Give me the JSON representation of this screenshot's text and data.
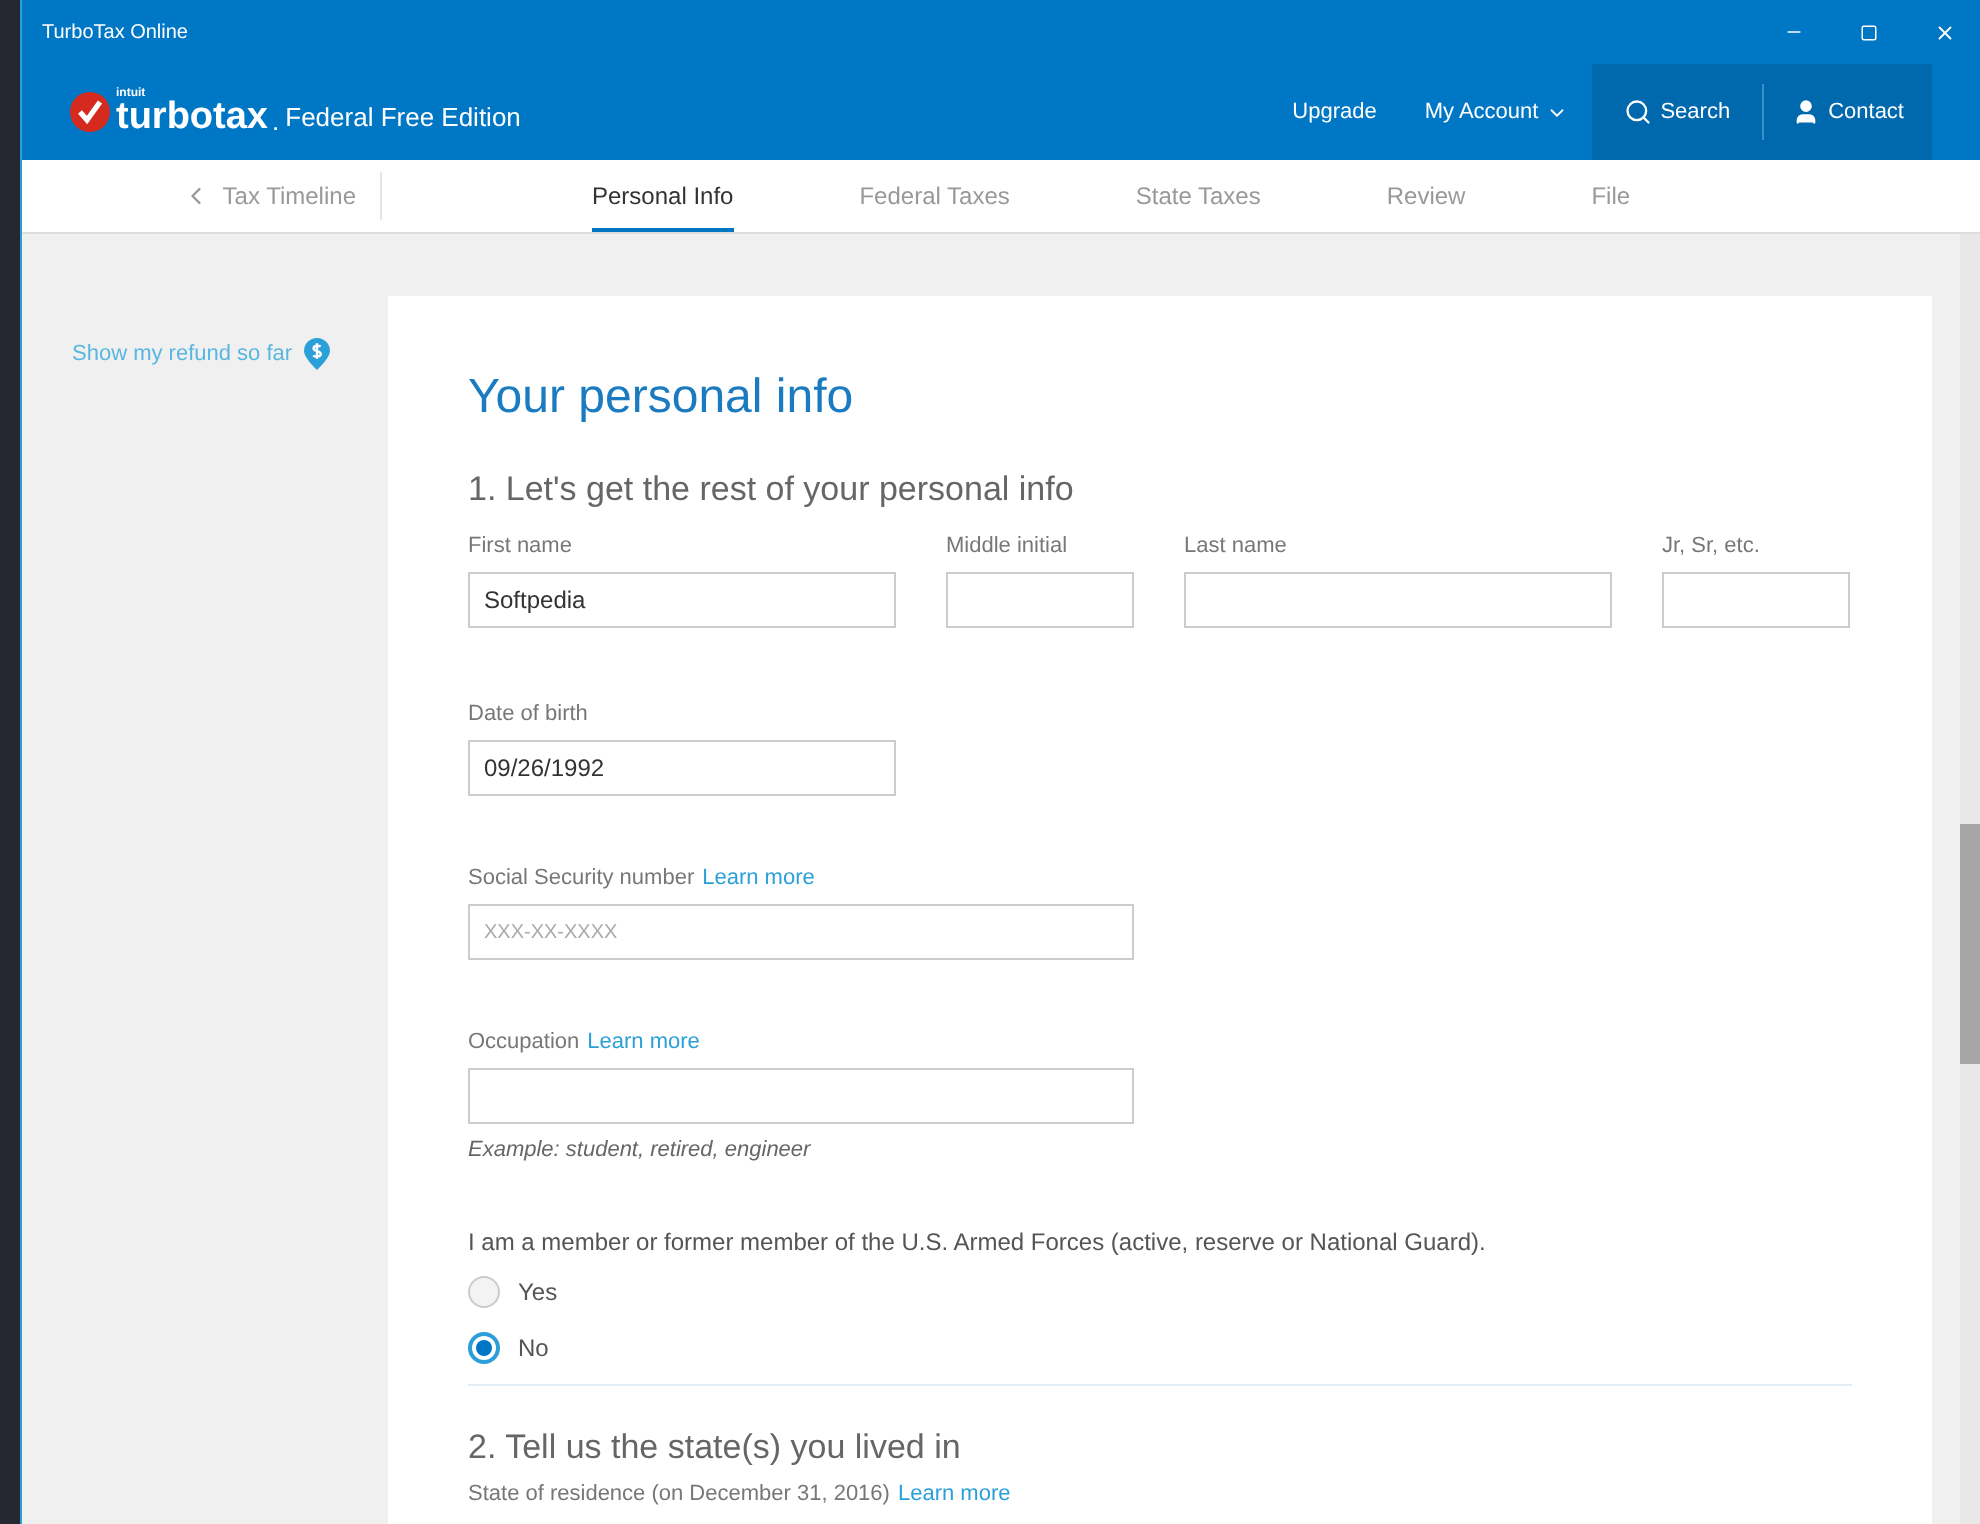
{
  "window": {
    "title": "TurboTax Online"
  },
  "header": {
    "brand_small": "intuit",
    "brand": "turbotax",
    "brand_dot": ".",
    "edition": "Federal Free Edition",
    "links": [
      "Upgrade",
      "My Account"
    ],
    "search": "Search",
    "contact": "Contact"
  },
  "nav": {
    "back": "Tax Timeline",
    "tabs": [
      {
        "label": "Personal Info",
        "selected": true
      },
      {
        "label": "Federal Taxes",
        "selected": false
      },
      {
        "label": "State Taxes",
        "selected": false
      },
      {
        "label": "Review",
        "selected": false
      },
      {
        "label": "File",
        "selected": false
      }
    ]
  },
  "sidebar": {
    "refund_link": "Show my refund so far"
  },
  "form": {
    "title": "Your personal info",
    "section_1": "1. Let's get the rest of your personal info",
    "name_fields": [
      {
        "label": "First name",
        "value": "Softpedia"
      },
      {
        "label": "Middle initial"
      },
      {
        "label": "Last name"
      },
      {
        "label": "Jr, Sr, etc."
      }
    ],
    "dob": {
      "label": "Date of birth",
      "value": "09/26/1992"
    },
    "ssn": {
      "label": "Social Security number",
      "link": "Learn more",
      "placeholder": "XXX-XX-XXXX"
    },
    "occupation": {
      "label": "Occupation",
      "link": "Learn more",
      "hint": "Example: student, retired, engineer"
    },
    "military": {
      "question": "I am a member or former member of the U.S. Armed Forces (active, reserve or National Guard).",
      "options": [
        {
          "label": "Yes",
          "selected": false
        },
        {
          "label": "No",
          "selected": true
        }
      ]
    },
    "section_2": "2. Tell us the state(s) you lived in",
    "residence": {
      "label": "State of residence (on December 31, 2016)",
      "link": "Learn more"
    }
  }
}
